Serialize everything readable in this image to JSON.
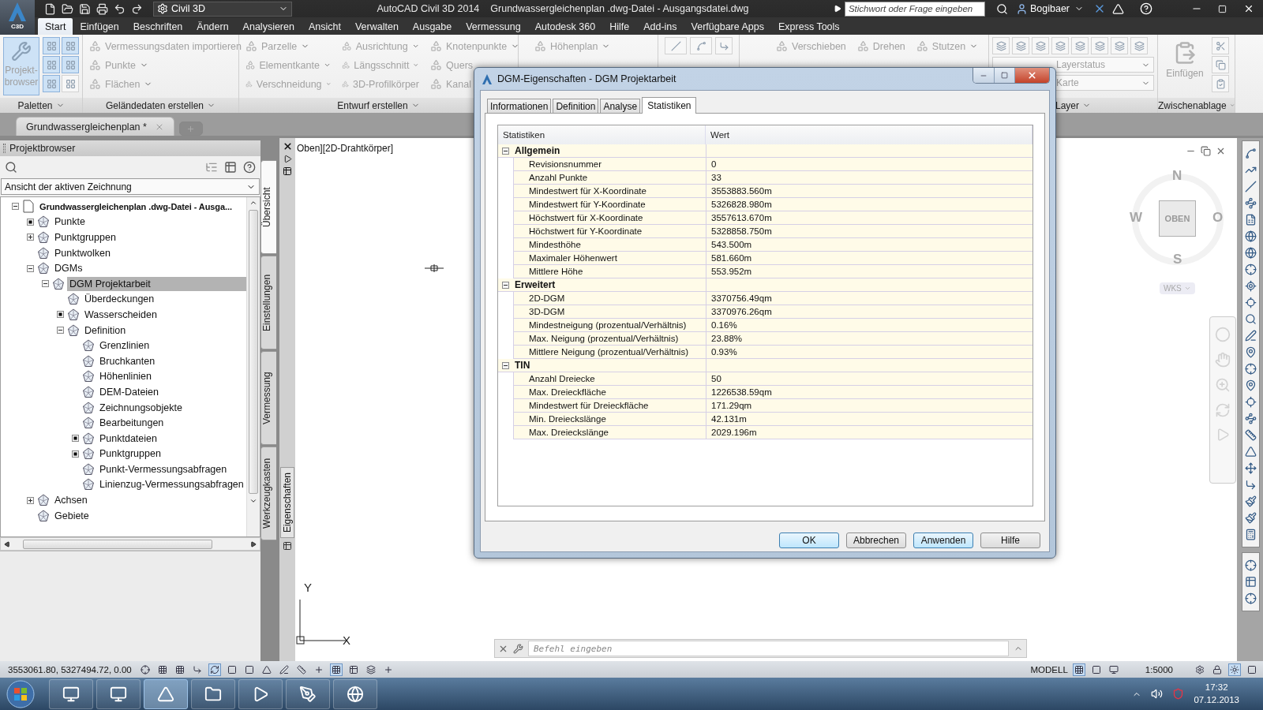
{
  "title_bar": {
    "logo": "C3D",
    "workspace": "Civil 3D",
    "app_name": "AutoCAD Civil 3D 2014",
    "file_name": "Grundwassergleichenplan .dwg-Datei - Ausgangsdatei.dwg",
    "search": {
      "placeholder": "Stichwort oder Frage eingeben"
    },
    "user": "Bogibaer"
  },
  "ribbon_tabs": [
    {
      "label": "Start",
      "selected": true
    },
    {
      "label": "Einfügen",
      "selected": false
    },
    {
      "label": "Beschriften",
      "selected": false
    },
    {
      "label": "Ändern",
      "selected": false
    },
    {
      "label": "Analysieren",
      "selected": false
    },
    {
      "label": "Ansicht",
      "selected": false
    },
    {
      "label": "Verwalten",
      "selected": false
    },
    {
      "label": "Ausgabe",
      "selected": false
    },
    {
      "label": "Vermessung",
      "selected": false
    },
    {
      "label": "Autodesk 360",
      "selected": false
    },
    {
      "label": "Hilfe",
      "selected": false
    },
    {
      "label": "Add-ins",
      "selected": false
    },
    {
      "label": "Verfügbare Apps",
      "selected": false
    },
    {
      "label": "Express Tools",
      "selected": false
    }
  ],
  "ribbon_panels": [
    {
      "kind": "palettes",
      "title": "Paletten",
      "button": "Projekt-browser"
    },
    {
      "kind": "tools",
      "title": "Geländedaten erstellen",
      "columns": [
        [
          {
            "label": "Vermessungsdaten importieren",
            "dropdown": false
          },
          {
            "label": "Punkte",
            "dropdown": true
          },
          {
            "label": "Flächen",
            "dropdown": true
          }
        ]
      ]
    },
    {
      "kind": "tools",
      "title": "Entwurf erstellen",
      "columns": [
        [
          {
            "label": "Parzelle",
            "dropdown": true
          },
          {
            "label": "Elementkante",
            "dropdown": true
          },
          {
            "label": "Verschneidung",
            "dropdown": true
          }
        ],
        [
          {
            "label": "Ausrichtung",
            "dropdown": true
          },
          {
            "label": "Längsschnitt",
            "dropdown": true
          },
          {
            "label": "3D-Profilkörper",
            "dropdown": false
          }
        ],
        [
          {
            "label": "Knotenpunkte",
            "dropdown": true
          },
          {
            "label": "Quers",
            "dropdown": false
          },
          {
            "label": "Kanal",
            "dropdown": false
          }
        ]
      ]
    },
    {
      "kind": "tools",
      "columns": [
        [
          {
            "label": "Höhenplan",
            "dropdown": true
          }
        ]
      ]
    },
    {
      "kind": "icons"
    },
    {
      "kind": "tools",
      "columns": [
        [
          {
            "label": "Verschieben",
            "dropdown": false
          }
        ],
        [
          {
            "label": "Drehen",
            "dropdown": false
          }
        ],
        [
          {
            "label": "Stutzen",
            "dropdown": true
          }
        ]
      ]
    },
    {
      "kind": "layer",
      "title": "Layer",
      "dropdowns": [
        "Layerstatus",
        "Karte"
      ]
    },
    {
      "kind": "clipboard",
      "title": "Zwischenablage",
      "button": "Einfügen"
    }
  ],
  "doc_tabs": [
    {
      "label": "Grundwassergleichenplan *",
      "selected": true
    }
  ],
  "palette": {
    "title": "Projektbrowser",
    "view": "Ansicht der aktiven Zeichnung",
    "tree": [
      {
        "label": "Grundwassergleichenplan .dwg-Datei - Ausga...",
        "kind": "branch",
        "expanded": true,
        "selected": false,
        "children": [
          {
            "label": "Punkte",
            "kind": "marker",
            "selected": false
          },
          {
            "label": "Punktgruppen",
            "kind": "branch",
            "expanded": false,
            "selected": false
          },
          {
            "label": "Punktwolken",
            "kind": "leaf",
            "selected": false
          },
          {
            "label": "DGMs",
            "kind": "branch",
            "expanded": true,
            "selected": false,
            "children": [
              {
                "label": "DGM Projektarbeit",
                "kind": "branch",
                "expanded": true,
                "selected": true,
                "children": [
                  {
                    "label": "Überdeckungen",
                    "kind": "leaf",
                    "selected": false
                  },
                  {
                    "label": "Wasserscheiden",
                    "kind": "marker",
                    "selected": false
                  },
                  {
                    "label": "Definition",
                    "kind": "branch",
                    "expanded": true,
                    "selected": false,
                    "children": [
                      {
                        "label": "Grenzlinien",
                        "kind": "leaf",
                        "selected": false
                      },
                      {
                        "label": "Bruchkanten",
                        "kind": "leaf",
                        "selected": false
                      },
                      {
                        "label": "Höhenlinien",
                        "kind": "leaf",
                        "selected": false
                      },
                      {
                        "label": "DEM-Dateien",
                        "kind": "leaf",
                        "selected": false
                      },
                      {
                        "label": "Zeichnungsobjekte",
                        "kind": "leaf",
                        "selected": false
                      },
                      {
                        "label": "Bearbeitungen",
                        "kind": "leaf",
                        "selected": false
                      },
                      {
                        "label": "Punktdateien",
                        "kind": "marker",
                        "selected": false
                      },
                      {
                        "label": "Punktgruppen",
                        "kind": "marker",
                        "selected": false
                      },
                      {
                        "label": "Punkt-Vermessungsabfragen",
                        "kind": "leaf",
                        "selected": false
                      },
                      {
                        "label": "Linienzug-Vermessungsabfragen",
                        "kind": "leaf",
                        "selected": false
                      }
                    ]
                  }
                ]
              }
            ]
          },
          {
            "label": "Achsen",
            "kind": "branch",
            "expanded": false,
            "selected": false
          },
          {
            "label": "Gebiete",
            "kind": "leaf",
            "selected": false
          }
        ]
      }
    ],
    "side_tabs": [
      {
        "label": "Übersicht",
        "selected": true
      },
      {
        "label": "Einstellungen",
        "selected": false
      },
      {
        "label": "Vermessung",
        "selected": false
      },
      {
        "label": "Werkzeugkasten",
        "selected": false
      }
    ],
    "properties_tab": "Eigenschaften"
  },
  "viewport": {
    "label": "Oben][2D-Drahtkörper]",
    "viewcube": {
      "north": "N",
      "west": "W",
      "east": "O",
      "south": "S",
      "face": "OBEN",
      "ucs": "WKS"
    },
    "axes": {
      "x": "X",
      "y": "Y"
    },
    "command": {
      "placeholder": "Befehl eingeben"
    }
  },
  "dialog": {
    "title": "DGM-Eigenschaften - DGM Projektarbeit",
    "tabs": [
      {
        "label": "Informationen",
        "selected": false
      },
      {
        "label": "Definition",
        "selected": false
      },
      {
        "label": "Analyse",
        "selected": false
      },
      {
        "label": "Statistiken",
        "selected": true
      }
    ],
    "columns": [
      "Statistiken",
      "Wert"
    ],
    "groups": [
      {
        "label": "Allgemein",
        "expanded": true,
        "rows": [
          {
            "name": "Revisionsnummer",
            "value": "0"
          },
          {
            "name": "Anzahl Punkte",
            "value": "33"
          },
          {
            "name": "Mindestwert für X-Koordinate",
            "value": "3553883.560m"
          },
          {
            "name": "Mindestwert für Y-Koordinate",
            "value": "5326828.980m"
          },
          {
            "name": "Höchstwert für X-Koordinate",
            "value": "3557613.670m"
          },
          {
            "name": "Höchstwert für Y-Koordinate",
            "value": "5328858.750m"
          },
          {
            "name": "Mindesthöhe",
            "value": "543.500m"
          },
          {
            "name": "Maximaler Höhenwert",
            "value": "581.660m"
          },
          {
            "name": "Mittlere Höhe",
            "value": "553.952m"
          }
        ]
      },
      {
        "label": "Erweitert",
        "expanded": true,
        "rows": [
          {
            "name": "2D-DGM",
            "value": "3370756.49qm"
          },
          {
            "name": "3D-DGM",
            "value": "3370976.26qm"
          },
          {
            "name": "Mindestneigung (prozentual/Verhältnis)",
            "value": "0.16%"
          },
          {
            "name": "Max. Neigung (prozentual/Verhältnis)",
            "value": "23.88%"
          },
          {
            "name": "Mittlere Neigung (prozentual/Verhältnis)",
            "value": "0.93%"
          }
        ]
      },
      {
        "label": "TIN",
        "expanded": true,
        "rows": [
          {
            "name": "Anzahl Dreiecke",
            "value": "50"
          },
          {
            "name": "Max. Dreieckfläche",
            "value": "1226538.59qm"
          },
          {
            "name": "Mindestwert für Dreieckfläche",
            "value": "171.29qm"
          },
          {
            "name": "Min. Dreieckslänge",
            "value": "42.131m"
          },
          {
            "name": "Max. Dreieckslänge",
            "value": "2029.196m"
          }
        ]
      }
    ],
    "buttons": [
      {
        "label": "OK",
        "highlighted": true
      },
      {
        "label": "Abbrechen",
        "highlighted": false
      },
      {
        "label": "Anwenden",
        "highlighted": true
      },
      {
        "label": "Hilfe",
        "highlighted": false
      }
    ]
  },
  "status_bar": {
    "coordinates": "3553061.80, 5327494.72, 0.00",
    "model": "MODELL",
    "scale": "1:5000"
  },
  "taskbar": {
    "time": "17:32",
    "date": "07.12.2013"
  }
}
